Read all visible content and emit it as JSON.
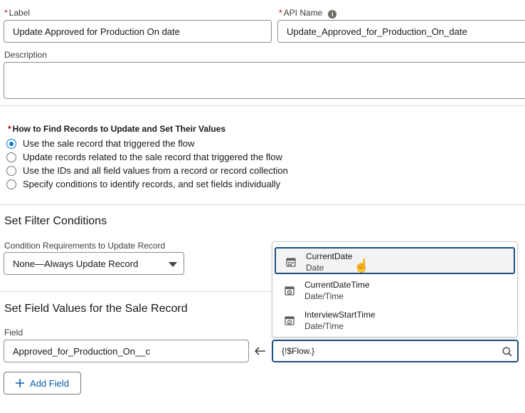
{
  "label_field": {
    "label": "Label",
    "value": "Update Approved for Production On date"
  },
  "api_name_field": {
    "label": "API Name",
    "value": "Update_Approved_for_Production_On_date"
  },
  "description_field": {
    "label": "Description",
    "value": ""
  },
  "find_records": {
    "label": "How to Find Records to Update and Set Their Values",
    "options": [
      {
        "label": "Use the sale record that triggered the flow",
        "selected": true
      },
      {
        "label": "Update records related to the sale record that triggered the flow",
        "selected": false
      },
      {
        "label": "Use the IDs and all field values from a record or record collection",
        "selected": false
      },
      {
        "label": "Specify conditions to identify records, and set fields individually",
        "selected": false
      }
    ]
  },
  "filter_conditions": {
    "title": "Set Filter Conditions",
    "requirements_label": "Condition Requirements to Update Record",
    "requirements_value": "None—Always Update Record"
  },
  "field_values": {
    "title": "Set Field Values for the Sale Record",
    "field_label": "Field",
    "field_value": "Approved_for_Production_On__c",
    "value_input": "{!$Flow.}",
    "add_field_label": "Add Field"
  },
  "dropdown": {
    "options": [
      {
        "name": "CurrentDate",
        "type": "Date",
        "icon": "calendar-icon",
        "highlighted": true
      },
      {
        "name": "CurrentDateTime",
        "type": "Date/Time",
        "icon": "calendar-clock-icon",
        "highlighted": false
      },
      {
        "name": "InterviewStartTime",
        "type": "Date/Time",
        "icon": "calendar-clock-icon",
        "highlighted": false
      }
    ]
  },
  "colors": {
    "accent": "#0176d3",
    "focus_border": "#1b4f85",
    "link": "#0b5cab",
    "required": "#ba0517"
  }
}
